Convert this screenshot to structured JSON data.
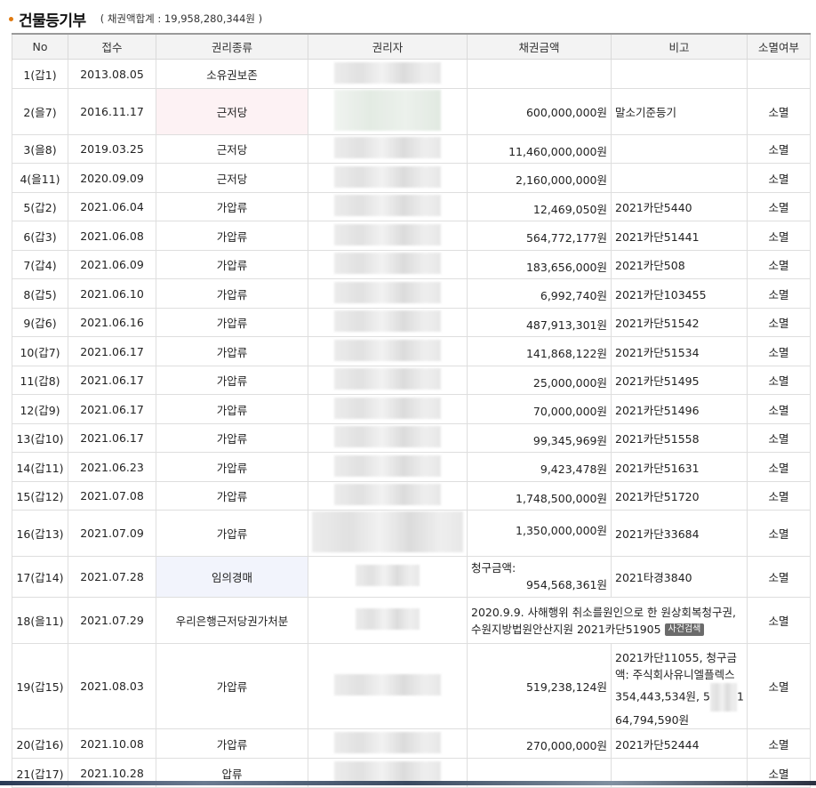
{
  "header": {
    "title": "건물등기부",
    "subtitle": "( 채권액합계 : 19,958,280,344원 )"
  },
  "columns": [
    "No",
    "접수",
    "권리종류",
    "권리자",
    "채권금액",
    "비고",
    "소멸여부"
  ],
  "rows": [
    {
      "no": "1(갑1)",
      "date": "2013.08.05",
      "type": "소유권보존",
      "amount": "",
      "memo": "",
      "status": ""
    },
    {
      "no": "2(을7)",
      "date": "2016.11.17",
      "type": "근저당",
      "amount": "600,000,000원",
      "memo": "말소기준등기",
      "status": "소멸"
    },
    {
      "no": "3(을8)",
      "date": "2019.03.25",
      "type": "근저당",
      "amount": "11,460,000,000원",
      "memo": "",
      "status": "소멸"
    },
    {
      "no": "4(을11)",
      "date": "2020.09.09",
      "type": "근저당",
      "amount": "2,160,000,000원",
      "memo": "",
      "status": "소멸"
    },
    {
      "no": "5(갑2)",
      "date": "2021.06.04",
      "type": "가압류",
      "amount": "12,469,050원",
      "memo": "2021카단5440",
      "status": "소멸"
    },
    {
      "no": "6(갑3)",
      "date": "2021.06.08",
      "type": "가압류",
      "amount": "564,772,177원",
      "memo": "2021카단51441",
      "status": "소멸"
    },
    {
      "no": "7(갑4)",
      "date": "2021.06.09",
      "type": "가압류",
      "amount": "183,656,000원",
      "memo": "2021카단508",
      "status": "소멸"
    },
    {
      "no": "8(갑5)",
      "date": "2021.06.10",
      "type": "가압류",
      "amount": "6,992,740원",
      "memo": "2021카단103455",
      "status": "소멸"
    },
    {
      "no": "9(갑6)",
      "date": "2021.06.16",
      "type": "가압류",
      "amount": "487,913,301원",
      "memo": "2021카단51542",
      "status": "소멸"
    },
    {
      "no": "10(갑7)",
      "date": "2021.06.17",
      "type": "가압류",
      "amount": "141,868,122원",
      "memo": "2021카단51534",
      "status": "소멸"
    },
    {
      "no": "11(갑8)",
      "date": "2021.06.17",
      "type": "가압류",
      "amount": "25,000,000원",
      "memo": "2021카단51495",
      "status": "소멸"
    },
    {
      "no": "12(갑9)",
      "date": "2021.06.17",
      "type": "가압류",
      "amount": "70,000,000원",
      "memo": "2021카단51496",
      "status": "소멸"
    },
    {
      "no": "13(갑10)",
      "date": "2021.06.17",
      "type": "가압류",
      "amount": "99,345,969원",
      "memo": "2021카단51558",
      "status": "소멸"
    },
    {
      "no": "14(갑11)",
      "date": "2021.06.23",
      "type": "가압류",
      "amount": "9,423,478원",
      "memo": "2021카단51631",
      "status": "소멸"
    },
    {
      "no": "15(갑12)",
      "date": "2021.07.08",
      "type": "가압류",
      "amount": "1,748,500,000원",
      "memo": "2021카단51720",
      "status": "소멸"
    },
    {
      "no": "16(갑13)",
      "date": "2021.07.09",
      "type": "가압류",
      "amount": "1,350,000,000원",
      "memo": "2021카단33684",
      "status": "소멸"
    },
    {
      "no": "17(갑14)",
      "date": "2021.07.28",
      "type": "임의경매",
      "amount_label": "청구금액:",
      "amount": "954,568,361원",
      "memo": "2021타경3840",
      "status": "소멸"
    },
    {
      "no": "18(을11)",
      "date": "2021.07.29",
      "type": "우리은행근저당권가처분",
      "amount": "",
      "memo": "2020.9.9. 사해행위 취소를원인으로 한 원상회복청구권, 수원지방법원안산지원 2021카단51905",
      "badge": "사건검색",
      "status": "소멸"
    },
    {
      "no": "19(갑15)",
      "date": "2021.08.03",
      "type": "가압류",
      "amount": "519,238,124원",
      "memo_a": "2021카단11055, 청구금액: 주식회사유니엘플렉스 354,443,534원, 5",
      "memo_b": "1",
      "memo_c": "64,794,590원",
      "status": "소멸"
    },
    {
      "no": "20(갑16)",
      "date": "2021.10.08",
      "type": "가압류",
      "amount": "270,000,000원",
      "memo": "2021카단52444",
      "status": "소멸"
    },
    {
      "no": "21(갑17)",
      "date": "2021.10.28",
      "type": "압류",
      "amount": "",
      "memo": "",
      "status": "소멸"
    }
  ]
}
